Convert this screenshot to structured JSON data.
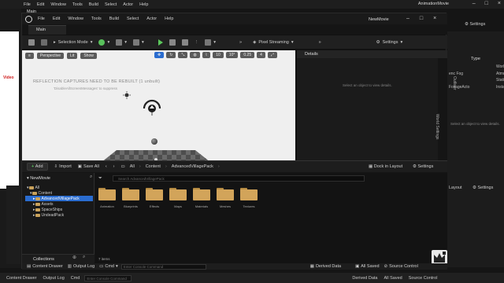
{
  "back_window": {
    "menus": [
      "File",
      "Edit",
      "Window",
      "Tools",
      "Build",
      "Select",
      "Actor",
      "Help"
    ],
    "title": "AnimationMovie",
    "tab_main": "Main",
    "video_text": "Video",
    "settings_label": "Settings",
    "outliner": {
      "type_header": "Type",
      "rows": [
        {
          "left": "",
          "right": "World"
        },
        {
          "left": "enc Fog",
          "right": "Atmospher"
        },
        {
          "left": "",
          "right": "StaticMesh"
        },
        {
          "left": "FoliageActo",
          "right": "InstancedF"
        }
      ],
      "select_hint": "Select an object to view details."
    },
    "layout_label": "Layout",
    "settings_label2": "Settings",
    "statusbar": {
      "content_drawer": "Content Drawer",
      "output_log": "Output Log",
      "cmd": "Cmd",
      "cmd_placeholder": "Enter Console Command",
      "derived_data": "Derived Data",
      "all_saved": "All Saved",
      "source_control": "Source Control"
    }
  },
  "front_window": {
    "menus": [
      "File",
      "Edit",
      "Window",
      "Tools",
      "Build",
      "Select",
      "Actor",
      "Help"
    ],
    "title": "NewMovie",
    "tab_main": "Main",
    "toolbar": {
      "selection_mode": "Selection Mode",
      "pixel_streaming": "Pixel Streaming",
      "settings": "Settings"
    },
    "viewport": {
      "perspective": "Perspective",
      "lit": "Lit",
      "show": "Show",
      "grid_snap": "10",
      "rot_snap": "10°",
      "scale_snap": "0.25",
      "cam_speed": "4",
      "warning": "REFLECTION CAPTURES NEED TO BE REBUILT (1 unbuilt)",
      "warning_sub": "'DisableAllScreenMessages' to suppress"
    },
    "details": {
      "tab": "Details",
      "empty": "Select an object to view details.",
      "side_tab": "World Settings",
      "outliner_tab": "Outliner"
    },
    "content_drawer": {
      "add": "Add",
      "import": "Import",
      "save_all": "Save All",
      "breadcrumbs": [
        "All",
        "Content",
        "AdvancedVillagePack"
      ],
      "dock_in_layout": "Dock in Layout",
      "settings": "Settings",
      "tree_root": "NewMovie",
      "tree": [
        {
          "label": "All",
          "indent": 0,
          "selected": false
        },
        {
          "label": "Content",
          "indent": 1,
          "selected": false
        },
        {
          "label": "AdvancedVillagePack",
          "indent": 2,
          "selected": true
        },
        {
          "label": "Assets",
          "indent": 2,
          "selected": false
        },
        {
          "label": "SpaceShips",
          "indent": 2,
          "selected": false
        },
        {
          "label": "UndeadPack",
          "indent": 2,
          "selected": false
        }
      ],
      "collections": "Collections",
      "search_placeholder": "Search AdvancedVillagePack",
      "folders": [
        "Animation",
        "Blueprints",
        "Effects",
        "Maps",
        "Materials",
        "Meshes",
        "Textures"
      ],
      "item_count": "7 items"
    },
    "statusbar": {
      "content_drawer": "Content Drawer",
      "output_log": "Output Log",
      "cmd": "Cmd",
      "cmd_placeholder": "Enter Console Command",
      "derived_data": "Derived Data",
      "all_saved": "All Saved",
      "source_control": "Source Control"
    }
  },
  "colors": {
    "accent_blue": "#2a6ccf",
    "folder": "#d2a45a",
    "play_green": "#5cc85c",
    "warning_red": "#d02020"
  }
}
